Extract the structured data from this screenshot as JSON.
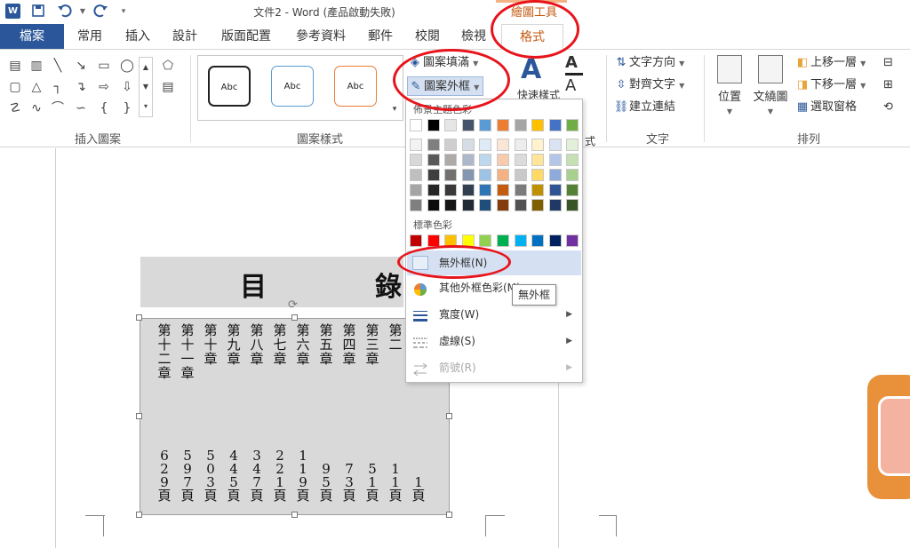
{
  "app": {
    "window_title": "文件2 - Word (產品啟動失敗)",
    "tool_context": "繪圖工具"
  },
  "tabs": [
    {
      "label": "檔案"
    },
    {
      "label": "常用"
    },
    {
      "label": "插入"
    },
    {
      "label": "設計"
    },
    {
      "label": "版面配置"
    },
    {
      "label": "參考資料"
    },
    {
      "label": "郵件"
    },
    {
      "label": "校閱"
    },
    {
      "label": "檢視"
    },
    {
      "label": "格式",
      "active": true
    }
  ],
  "ribbon": {
    "insert_shapes_label": "插入圖案",
    "shape_styles_label": "圖案樣式",
    "style_preview_text": [
      "Abc",
      "Abc",
      "Abc"
    ],
    "style_preview_colors": [
      "#222222",
      "#5b9bd5",
      "#ed7d31"
    ],
    "shape_fill": "圖案填滿",
    "shape_outline": "圖案外框",
    "quick_styles_partial": "快速樣式",
    "text_group": {
      "label": "文字",
      "direction": "文字方向",
      "align": "對齊文字",
      "link": "建立連結"
    },
    "arrange_group": {
      "label": "排列",
      "position": "位置",
      "wrap": "文繞圖",
      "bring_forward": "上移一層",
      "send_backward": "下移一層",
      "selection_pane": "選取窗格"
    },
    "wordart_group_label_partial": "式"
  },
  "document": {
    "toc_title": "目　錄",
    "chapters": [
      "第十二章",
      "第十一章",
      "第十章",
      "第九章",
      "第八章",
      "第七章",
      "第六章",
      "第五章",
      "第四章",
      "第三章",
      "第二"
    ],
    "pages": [
      "629頁",
      "597頁",
      "503頁",
      "445頁",
      "347頁",
      "221頁",
      "119頁",
      "95頁",
      "73頁",
      "51頁",
      "11頁",
      "1頁"
    ]
  },
  "dropdown": {
    "theme_colors_label": "佈景主題色彩",
    "standard_colors_label": "標準色彩",
    "theme_top_row": [
      "#ffffff",
      "#000000",
      "#e7e6e6",
      "#44546a",
      "#5b9bd5",
      "#ed7d31",
      "#a5a5a5",
      "#ffc000",
      "#4472c4",
      "#70ad47"
    ],
    "theme_shades": [
      [
        "#f2f2f2",
        "#7f7f7f",
        "#d0cece",
        "#d6dce4",
        "#deebf6",
        "#fbe5d5",
        "#ededed",
        "#fff2cc",
        "#dae3f3",
        "#e2efd9"
      ],
      [
        "#d8d8d8",
        "#595959",
        "#aeaaaa",
        "#adb9ca",
        "#bdd7ee",
        "#f7cbac",
        "#dbdbdb",
        "#fee599",
        "#b4c6e7",
        "#c5e0b3"
      ],
      [
        "#bfbfbf",
        "#3f3f3f",
        "#757070",
        "#8496b0",
        "#9cc3e5",
        "#f4b183",
        "#c9c9c9",
        "#ffd965",
        "#8eaadb",
        "#a8d08d"
      ],
      [
        "#a5a5a5",
        "#262626",
        "#3a3838",
        "#323f4f",
        "#2e75b5",
        "#c55a11",
        "#7b7b7b",
        "#bf9000",
        "#2f5496",
        "#538135"
      ],
      [
        "#7f7f7f",
        "#0c0c0c",
        "#171616",
        "#222a35",
        "#1e4e79",
        "#833c0b",
        "#525252",
        "#7f6000",
        "#1f3864",
        "#375623"
      ]
    ],
    "standard_colors": [
      "#c00000",
      "#ff0000",
      "#ffc000",
      "#ffff00",
      "#92d050",
      "#00b050",
      "#00b0f0",
      "#0070c0",
      "#002060",
      "#7030a0"
    ],
    "no_outline": "無外框(N)",
    "more_colors": "其他外框色彩(M)...",
    "weight": "寬度(W)",
    "dashes": "虛線(S)",
    "arrows": "箭號(R)"
  },
  "tooltip": "無外框",
  "annotation_color": "#e8141c"
}
